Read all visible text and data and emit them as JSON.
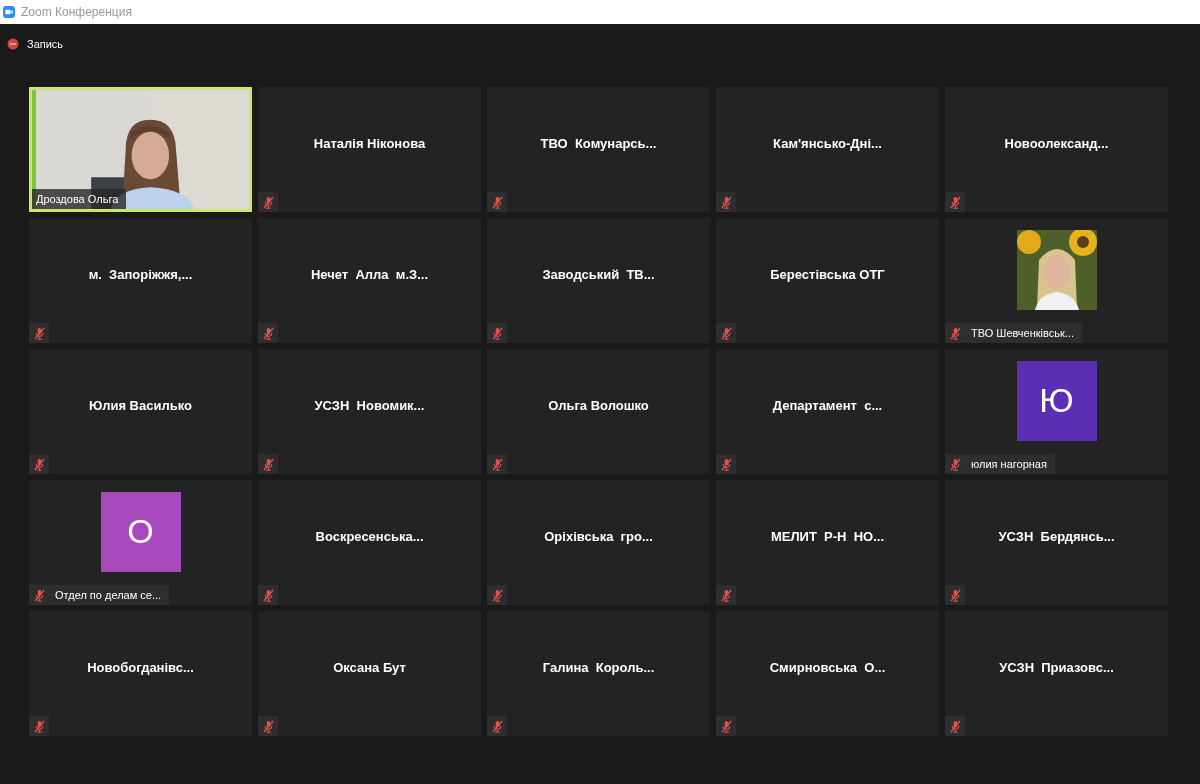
{
  "window": {
    "title": "Zoom Конференция"
  },
  "recording": {
    "label": "Запись"
  },
  "tiles": [
    {
      "kind": "video",
      "name": "Дроздова Ольга",
      "muted": false,
      "speaking": true
    },
    {
      "kind": "name",
      "name": "Наталія Ніконова",
      "muted": true,
      "speaking": false
    },
    {
      "kind": "name",
      "name": "ТВО  Комунарсь...",
      "muted": true,
      "speaking": false
    },
    {
      "kind": "name",
      "name": "Кам'янсько-Дні...",
      "muted": true,
      "speaking": false
    },
    {
      "kind": "name",
      "name": "Новоолександ...",
      "muted": true,
      "speaking": false
    },
    {
      "kind": "name",
      "name": "м.  Запоріжжя,...",
      "muted": true,
      "speaking": false
    },
    {
      "kind": "name",
      "name": "Нечет  Алла  м.З...",
      "muted": true,
      "speaking": false
    },
    {
      "kind": "name",
      "name": "Заводський  ТВ...",
      "muted": true,
      "speaking": false
    },
    {
      "kind": "name",
      "name": "Берестівська ОТГ",
      "muted": true,
      "speaking": false
    },
    {
      "name": "ТВО Шевченківськ...",
      "muted": true,
      "speaking": false
    },
    {
      "kind": "name",
      "name": "Юлия Василько",
      "muted": true,
      "speaking": false
    },
    {
      "kind": "name",
      "name": "УСЗН  Новомик...",
      "muted": true,
      "speaking": false
    },
    {
      "kind": "name",
      "name": "Ольга Волошко",
      "muted": true,
      "speaking": false
    },
    {
      "kind": "name",
      "name": "Департамент  с...",
      "muted": true,
      "speaking": false
    },
    {
      "kind": "avatar",
      "name": "юлия нагорная",
      "initial": "Ю",
      "color": "#5a2fb3",
      "muted": true,
      "speaking": false
    },
    {
      "kind": "avatar",
      "name": "Отдел по делам се...",
      "initial": "О",
      "color": "#a848bd",
      "muted": true,
      "speaking": false
    },
    {
      "kind": "name",
      "name": "Воскресенська...",
      "muted": true,
      "speaking": false
    },
    {
      "kind": "name",
      "name": "Оріхівська  гро...",
      "muted": true,
      "speaking": false
    },
    {
      "kind": "name",
      "name": "МЕЛИТ  Р-Н  НО...",
      "muted": true,
      "speaking": false
    },
    {
      "kind": "name",
      "name": "УСЗН  Бердянсь...",
      "muted": true,
      "speaking": false
    },
    {
      "kind": "name",
      "name": "Новобогданівс...",
      "muted": true,
      "speaking": false
    },
    {
      "kind": "name",
      "name": "Оксана Бут",
      "muted": true,
      "speaking": false
    },
    {
      "kind": "name",
      "name": "Галина  Король...",
      "muted": true,
      "speaking": false
    },
    {
      "kind": "name",
      "name": "Смирновська  О...",
      "muted": true,
      "speaking": false
    },
    {
      "kind": "name",
      "name": "УСЗН  Приазовс...",
      "muted": true,
      "speaking": false
    }
  ]
}
